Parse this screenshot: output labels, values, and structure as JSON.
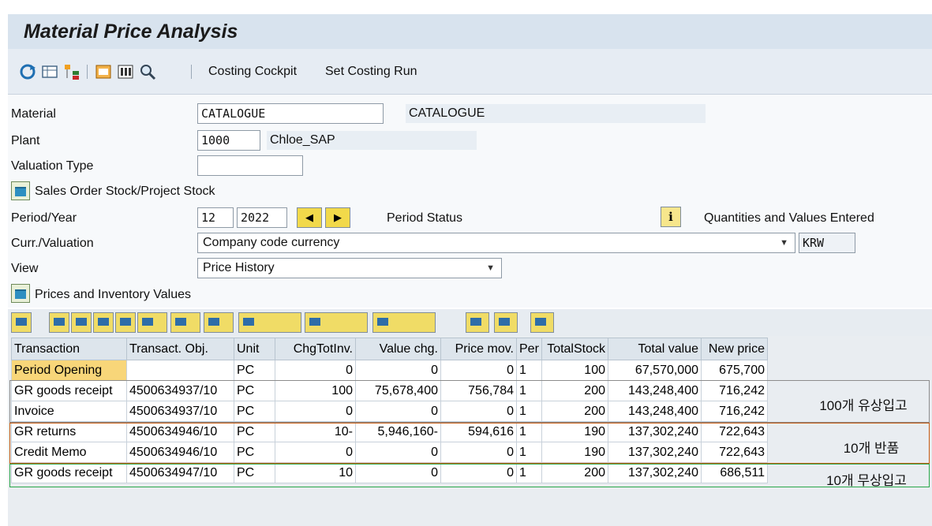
{
  "title": "Material Price Analysis",
  "toolbar": {
    "icons": [
      "refresh-icon",
      "table-icon",
      "hierarchy-icon",
      "display-icon",
      "columns-icon",
      "search-icon"
    ],
    "costing_cockpit": "Costing Cockpit",
    "set_costing_run": "Set Costing Run"
  },
  "form": {
    "material_label": "Material",
    "material_value": "CATALOGUE",
    "material_desc": "CATALOGUE",
    "plant_label": "Plant",
    "plant_value": "1000",
    "plant_desc": "Chloe_SAP",
    "valuation_type_label": "Valuation Type",
    "valuation_type_value": "",
    "sales_order_label": "Sales Order Stock/Project Stock",
    "period_year_label": "Period/Year",
    "period_value": "12",
    "year_value": "2022",
    "period_status_label": "Period Status",
    "quantities_label": "Quantities and Values Entered",
    "curr_valuation_label": "Curr./Valuation",
    "curr_valuation_value": "Company code currency",
    "currency": "KRW",
    "view_label": "View",
    "view_value": "Price History",
    "prices_inventory_label": "Prices and Inventory Values"
  },
  "table": {
    "headers": [
      "Transaction",
      "Transact. Obj.",
      "Unit",
      "ChgTotInv.",
      "Value chg.",
      "Price mov.",
      "Per",
      "TotalStock",
      "Total value",
      "New price"
    ],
    "rows": [
      [
        "Period Opening",
        "",
        "PC",
        "0",
        "0",
        "0",
        "1",
        "100",
        "67,570,000",
        "675,700"
      ],
      [
        "GR goods receipt",
        "4500634937/10",
        "PC",
        "100",
        "75,678,400",
        "756,784",
        "1",
        "200",
        "143,248,400",
        "716,242"
      ],
      [
        "Invoice",
        "4500634937/10",
        "PC",
        "0",
        "0",
        "0",
        "1",
        "200",
        "143,248,400",
        "716,242"
      ],
      [
        "GR returns",
        "4500634946/10",
        "PC",
        "10-",
        "5,946,160-",
        "594,616",
        "1",
        "190",
        "137,302,240",
        "722,643"
      ],
      [
        "Credit Memo",
        "4500634946/10",
        "PC",
        "0",
        "0",
        "0",
        "1",
        "190",
        "137,302,240",
        "722,643"
      ],
      [
        "GR goods receipt",
        "4500634947/10",
        "PC",
        "10",
        "0",
        "0",
        "1",
        "200",
        "137,302,240",
        "686,511"
      ]
    ]
  },
  "annotations": {
    "note1": "100개 유상입고",
    "note2": "10개 반품",
    "note3": "10개 무상입고",
    "color_gray": "#8c8c8c",
    "color_orange": "#c55a11",
    "color_green": "#2aa84a"
  }
}
